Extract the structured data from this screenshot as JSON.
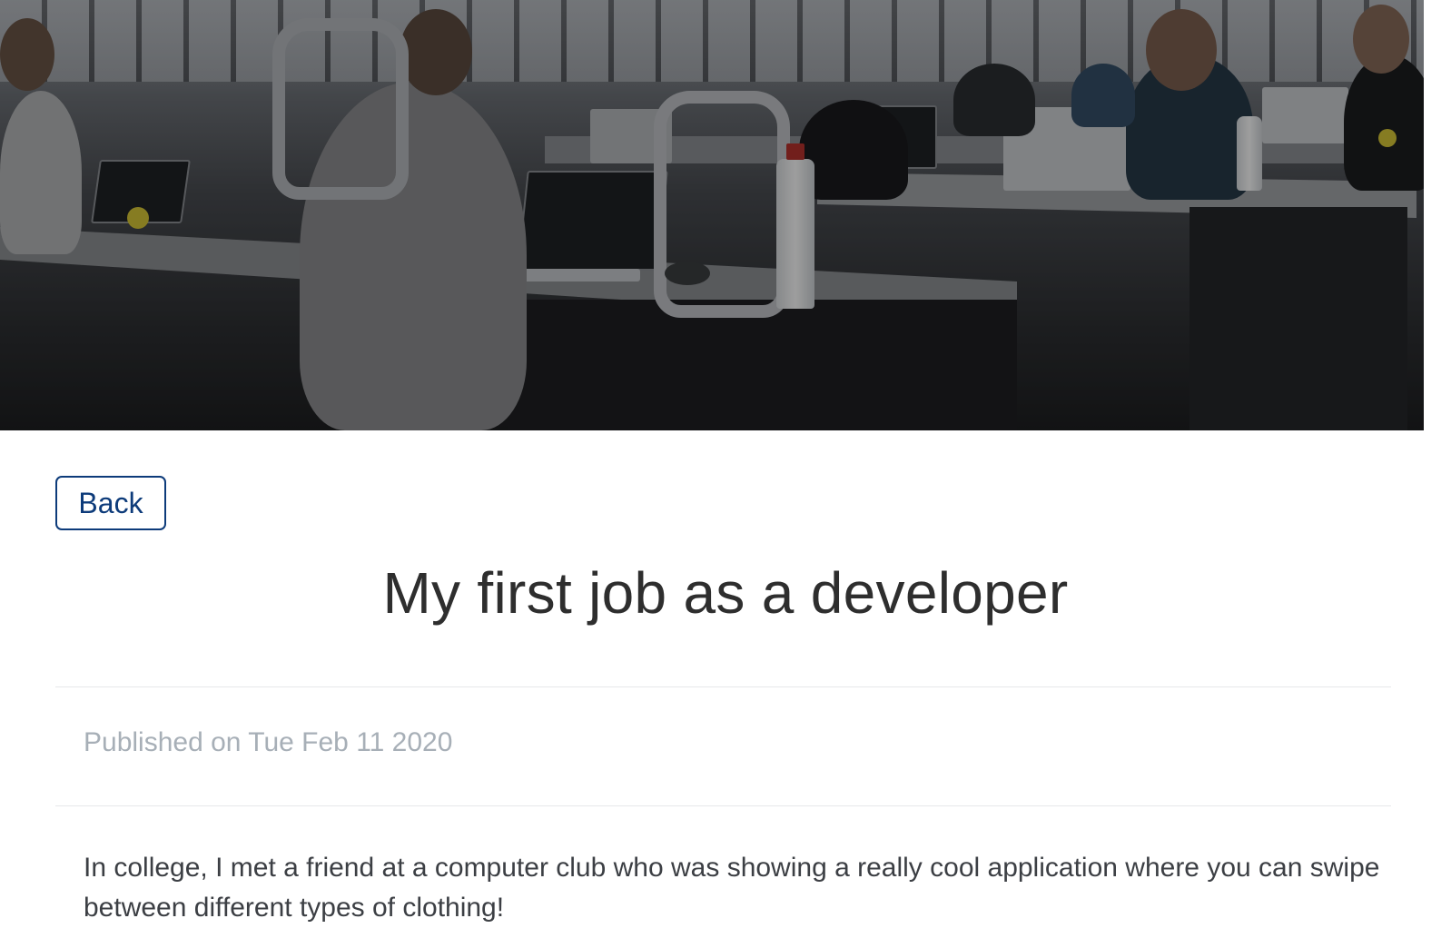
{
  "hero": {
    "image_subject": "open-plan office with developers working at laptops"
  },
  "nav": {
    "back_label": "Back"
  },
  "post": {
    "title": "My first job as a developer",
    "published": "Published on Tue Feb 11 2020",
    "body": "In college, I met a friend at a computer club who was showing a really cool application where you can swipe between different types of clothing!"
  },
  "colors": {
    "accent": "#0d3b7a",
    "title_text": "#2e2e2e",
    "meta_text": "#a7afb7",
    "body_text": "#3c3f44",
    "divider": "#e6e8ea"
  }
}
